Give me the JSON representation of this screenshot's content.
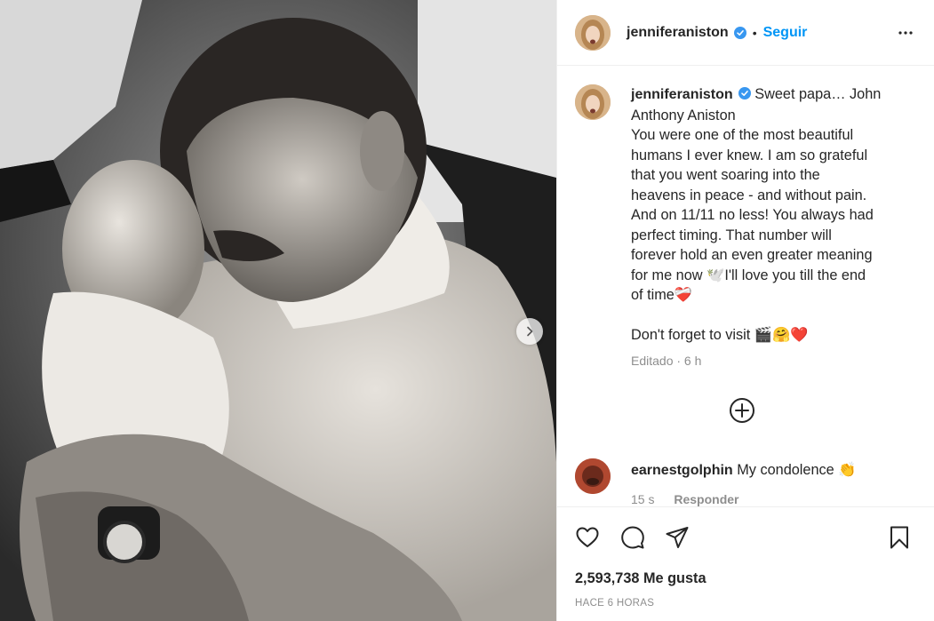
{
  "post": {
    "username": "jenniferaniston",
    "follow_label": "Seguir",
    "separator": "•",
    "caption_lines": [
      "Sweet papa… John",
      "Anthony Aniston",
      "You were one of the most beautiful",
      "humans I ever knew. I am so grateful",
      "that you went soaring into the",
      "heavens in peace - and without pain.",
      "And on 11/11 no less! You always had",
      "perfect timing. That number will",
      "forever hold an even greater meaning",
      "for me now 🕊️I'll love you till the end",
      "of time❤️‍🩹",
      "",
      "Don't forget to visit 🎬🤗❤️"
    ],
    "caption_meta": "Editado · 6 h",
    "likes": "2,593,738 Me gusta",
    "timestamp": "HACE 6 HORAS"
  },
  "comment": {
    "username": "earnestgolphin",
    "text": "My condolence 👏",
    "age": "15 s",
    "reply_label": "Responder"
  },
  "colors": {
    "accent": "#0095f6",
    "verified": "#3897f0",
    "text": "#262626",
    "muted": "#8e8e8e",
    "divider": "#efefef"
  },
  "icons": {
    "next": "chevron-right-icon",
    "more": "more-options-icon",
    "load_more": "plus-circle-icon",
    "like": "heart-icon",
    "comment": "comment-icon",
    "share": "share-icon",
    "save": "bookmark-icon",
    "verified": "verified-badge-icon"
  }
}
